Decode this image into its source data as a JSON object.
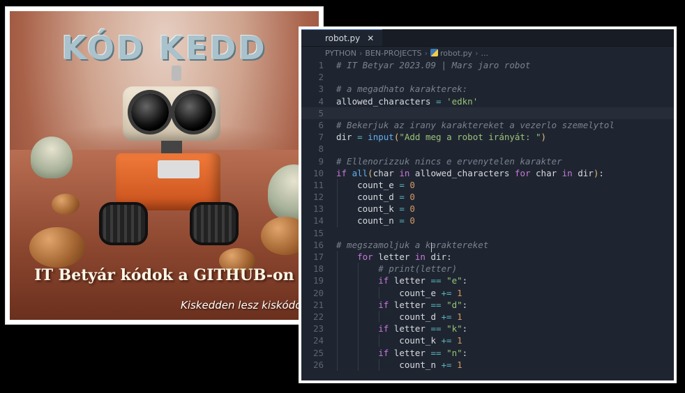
{
  "poster": {
    "title": "KÓD KEDD",
    "subtitle": "IT Betyár kódok a GITHUB-on",
    "tagline": "Kiskedden lesz kiskódom"
  },
  "editor": {
    "tab": {
      "filename": "robot.py",
      "close_glyph": "✕"
    },
    "breadcrumb": [
      "PYTHON",
      "BEN-PROJECTS",
      "robot.py",
      "..."
    ],
    "lines": [
      {
        "n": "1",
        "text": "# IT Betyar 2023.09 | Mars jaro robot"
      },
      {
        "n": "2",
        "text": ""
      },
      {
        "n": "3",
        "text": "# a megadhato karakterek:"
      },
      {
        "n": "4",
        "text": "allowed_characters = 'edkn'"
      },
      {
        "n": "5",
        "text": ""
      },
      {
        "n": "6",
        "text": "# Bekerjuk az irany karaktereket a vezerlo szemelytol"
      },
      {
        "n": "7",
        "text": "dir = input(\"Add meg a robot irányát: \")"
      },
      {
        "n": "8",
        "text": ""
      },
      {
        "n": "9",
        "text": "# Ellenorizzuk nincs e ervenytelen karakter"
      },
      {
        "n": "10",
        "text": "if all(char in allowed_characters for char in dir):"
      },
      {
        "n": "11",
        "text": "    count_e = 0"
      },
      {
        "n": "12",
        "text": "    count_d = 0"
      },
      {
        "n": "13",
        "text": "    count_k = 0"
      },
      {
        "n": "14",
        "text": "    count_n = 0"
      },
      {
        "n": "15",
        "text": ""
      },
      {
        "n": "16",
        "text": "# megszamoljuk a karaktereket"
      },
      {
        "n": "17",
        "text": "    for letter in dir:"
      },
      {
        "n": "18",
        "text": "        # print(letter)"
      },
      {
        "n": "19",
        "text": "        if letter == \"e\":"
      },
      {
        "n": "20",
        "text": "            count_e += 1"
      },
      {
        "n": "21",
        "text": "        if letter == \"d\":"
      },
      {
        "n": "22",
        "text": "            count_d += 1"
      },
      {
        "n": "23",
        "text": "        if letter == \"k\":"
      },
      {
        "n": "24",
        "text": "            count_k += 1"
      },
      {
        "n": "25",
        "text": "        if letter == \"n\":"
      },
      {
        "n": "26",
        "text": "            count_n += 1"
      }
    ]
  },
  "colors": {
    "editor_bg": "#1f2530",
    "comment": "#7a8290",
    "keyword": "#c678dd",
    "function": "#61afef",
    "string": "#98c379",
    "number": "#d19a66"
  }
}
